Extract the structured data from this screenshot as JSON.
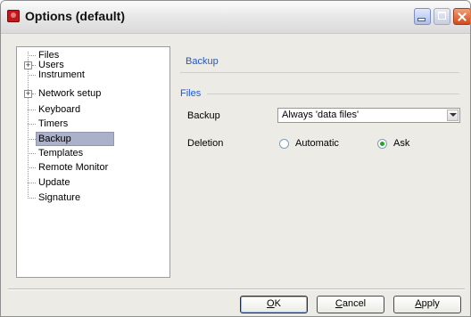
{
  "window": {
    "title": "Options (default)"
  },
  "tree": {
    "items": [
      {
        "label": "Files",
        "expandable": false
      },
      {
        "label": "Users",
        "expandable": true
      },
      {
        "label": "Instrument",
        "expandable": false
      },
      {
        "label": "Network setup",
        "expandable": true
      },
      {
        "label": "Keyboard",
        "expandable": false
      },
      {
        "label": "Timers",
        "expandable": false
      },
      {
        "label": "Backup",
        "expandable": false,
        "selected": true
      },
      {
        "label": "Templates",
        "expandable": false
      },
      {
        "label": "Remote Monitor",
        "expandable": false
      },
      {
        "label": "Update",
        "expandable": false
      },
      {
        "label": "Signature",
        "expandable": false
      }
    ],
    "expander_symbol": "+"
  },
  "panel": {
    "section_title": "Backup",
    "group_title": "Files",
    "backup_label": "Backup",
    "backup_value": "Always 'data files'",
    "deletion_label": "Deletion",
    "deletion_options": [
      {
        "label": "Automatic",
        "checked": false
      },
      {
        "label": "Ask",
        "checked": true
      }
    ]
  },
  "buttons": {
    "ok": {
      "mnemonic": "O",
      "rest": "K"
    },
    "cancel": {
      "mnemonic": "C",
      "rest": "ancel"
    },
    "apply": {
      "mnemonic": "A",
      "rest": "pply"
    }
  },
  "colors": {
    "accent_text": "#2158c3",
    "selection": "#aab1c8",
    "close_button": "#d3491d",
    "app_icon": "#c0181b",
    "radio_checked": "#2aa22a"
  }
}
